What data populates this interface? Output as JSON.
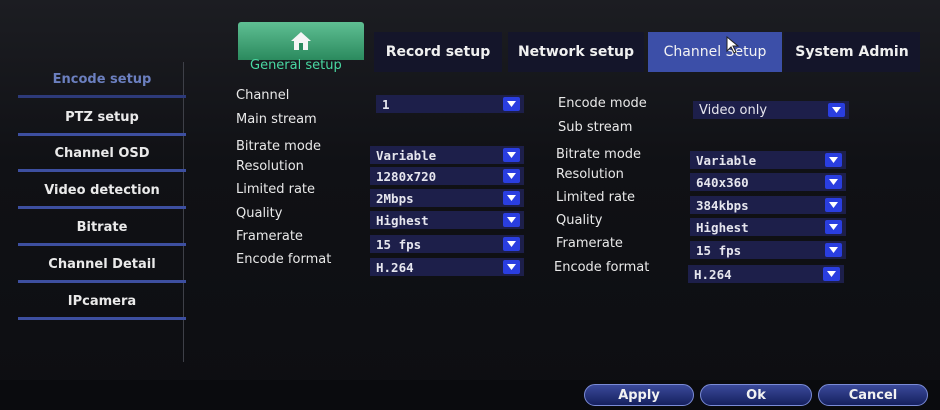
{
  "tabs": [
    {
      "label": "Record setup"
    },
    {
      "label": "Network setup"
    },
    {
      "label": "Channel Setup"
    },
    {
      "label": "System Admin"
    }
  ],
  "subtitle": "General setup",
  "sidebar": [
    {
      "label": "Encode setup"
    },
    {
      "label": "PTZ setup"
    },
    {
      "label": "Channel OSD"
    },
    {
      "label": "Video detection"
    },
    {
      "label": "Bitrate"
    },
    {
      "label": "Channel Detail"
    },
    {
      "label": "IPcamera"
    }
  ],
  "form": {
    "channel_label": "Channel",
    "channel_value": "1",
    "encode_mode_label": "Encode mode",
    "encode_mode_value": "Video only",
    "main_stream_label": "Main stream",
    "sub_stream_label": "Sub stream",
    "main": {
      "bitrate_mode_label": "Bitrate mode",
      "bitrate_mode": "Variable",
      "resolution_label": "Resolution",
      "resolution": "1280x720",
      "limited_rate_label": "Limited rate",
      "limited_rate": "2Mbps",
      "quality_label": "Quality",
      "quality": "Highest",
      "framerate_label": "Framerate",
      "framerate": "15 fps",
      "encode_format_label": "Encode format",
      "encode_format": "H.264"
    },
    "sub": {
      "bitrate_mode_label": "Bitrate mode",
      "bitrate_mode": "Variable",
      "resolution_label": "Resolution",
      "resolution": "640x360",
      "limited_rate_label": "Limited rate",
      "limited_rate": "384kbps",
      "quality_label": "Quality",
      "quality": "Highest",
      "framerate_label": "Framerate",
      "framerate": "15 fps",
      "encode_format_label": "Encode format",
      "encode_format": "H.264"
    }
  },
  "buttons": {
    "apply": "Apply",
    "ok": "Ok",
    "cancel": "Cancel"
  },
  "colors": {
    "accent": "#2a3ee0",
    "home": "#3aa473",
    "subtitle": "#49d8a2"
  }
}
